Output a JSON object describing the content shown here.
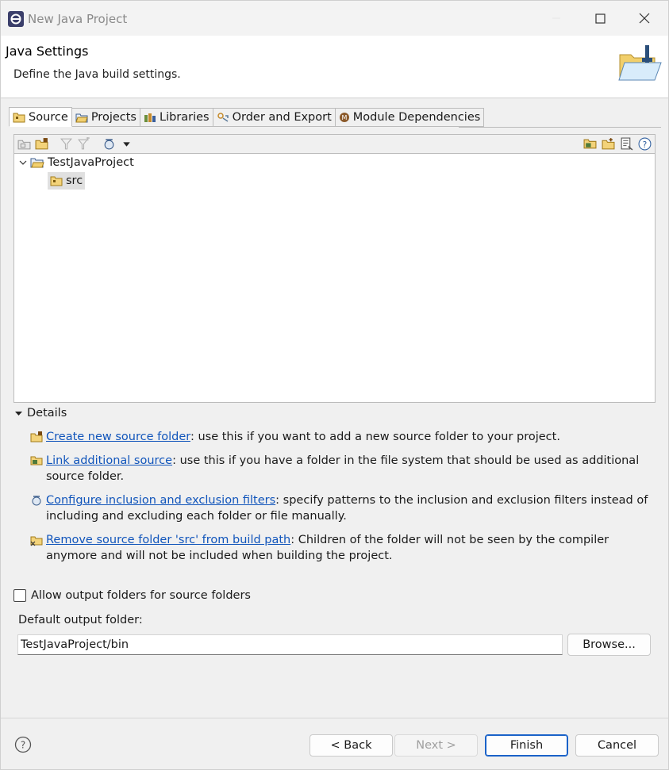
{
  "window": {
    "title": "New Java Project"
  },
  "header": {
    "title": "Java Settings",
    "description": "Define the Java build settings."
  },
  "tabs": [
    {
      "label": "Source",
      "icon": "source-folder-icon",
      "active": true
    },
    {
      "label": "Projects",
      "icon": "projects-icon",
      "active": false
    },
    {
      "label": "Libraries",
      "icon": "libraries-icon",
      "active": false
    },
    {
      "label": "Order and Export",
      "icon": "order-export-icon",
      "active": false
    },
    {
      "label": "Module Dependencies",
      "icon": "module-icon",
      "active": false
    }
  ],
  "tree": {
    "project": "TestJavaProject",
    "folder": "src"
  },
  "details": {
    "heading": "Details",
    "items": [
      {
        "link": "Create new source folder",
        "text": ": use this if you want to add a new source folder to your project."
      },
      {
        "link": "Link additional source",
        "text": ": use this if you have a folder in the file system that should be used as additional source folder."
      },
      {
        "link": "Configure inclusion and exclusion filters",
        "text": ": specify patterns to the inclusion and exclusion filters instead of including and excluding each folder or file manually."
      },
      {
        "link": "Remove source folder 'src' from build path",
        "text": ": Children of the folder will not be seen by the compiler anymore and will not be included when building the project."
      }
    ]
  },
  "output": {
    "allow_label": "Allow output folders for source folders",
    "default_label": "Default output folder:",
    "default_value": "TestJavaProject/bin",
    "browse_label": "Browse..."
  },
  "buttons": {
    "back": "< Back",
    "next": "Next >",
    "finish": "Finish",
    "cancel": "Cancel"
  },
  "colors": {
    "link": "#1155bb",
    "accent": "#1a62c8"
  }
}
